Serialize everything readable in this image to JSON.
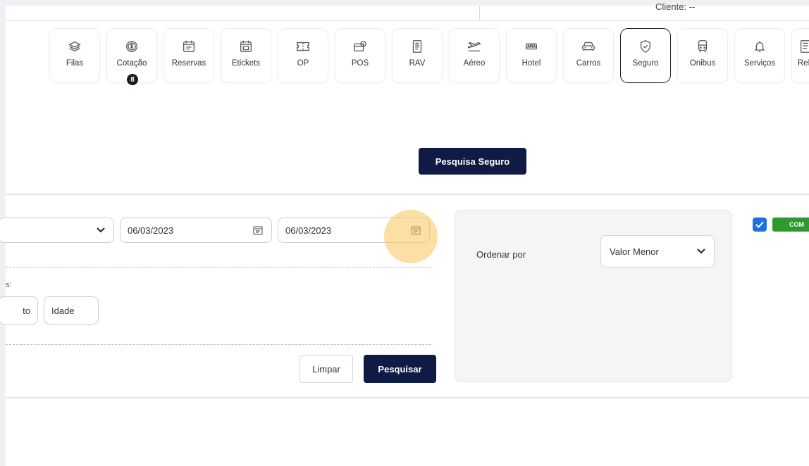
{
  "header": {
    "cliente_label": "Cliente: --"
  },
  "nav": {
    "items": [
      {
        "label": "Filas",
        "icon": "layers-icon"
      },
      {
        "label": "Cotação",
        "icon": "dollar-coin-icon",
        "badge": "8"
      },
      {
        "label": "Reservas",
        "icon": "calendar-icon"
      },
      {
        "label": "Etickets",
        "icon": "ticket-calendar-icon"
      },
      {
        "label": "OP",
        "icon": "ticket-icon"
      },
      {
        "label": "POS",
        "icon": "card-icon"
      },
      {
        "label": "RAV",
        "icon": "document-icon"
      },
      {
        "label": "Aéreo",
        "icon": "airplane-icon"
      },
      {
        "label": "Hotel",
        "icon": "bed-icon"
      },
      {
        "label": "Carros",
        "icon": "car-icon"
      },
      {
        "label": "Seguro",
        "icon": "shield-check-icon",
        "active": true
      },
      {
        "label": "Onibus",
        "icon": "bus-icon"
      },
      {
        "label": "Serviços",
        "icon": "bell-icon"
      },
      {
        "label": "Relat",
        "icon": "report-icon"
      }
    ]
  },
  "search_section": {
    "button_label": "Pesquisa Seguro"
  },
  "form": {
    "date_start": "06/03/2023",
    "date_end": "06/03/2023",
    "partial_label": "s:",
    "chip_partial": "to",
    "chip_idade": "Idade",
    "clear_label": "Limpar",
    "search_label": "Pesquisar"
  },
  "order_panel": {
    "label": "Ordenar por",
    "selected": "Valor Menor"
  },
  "tag": {
    "text": "COM"
  },
  "colors": {
    "navy": "#0f1a45",
    "highlight": "#f7c45a",
    "checkbox_blue": "#1f6fe0",
    "tag_green": "#2d9a2d"
  }
}
